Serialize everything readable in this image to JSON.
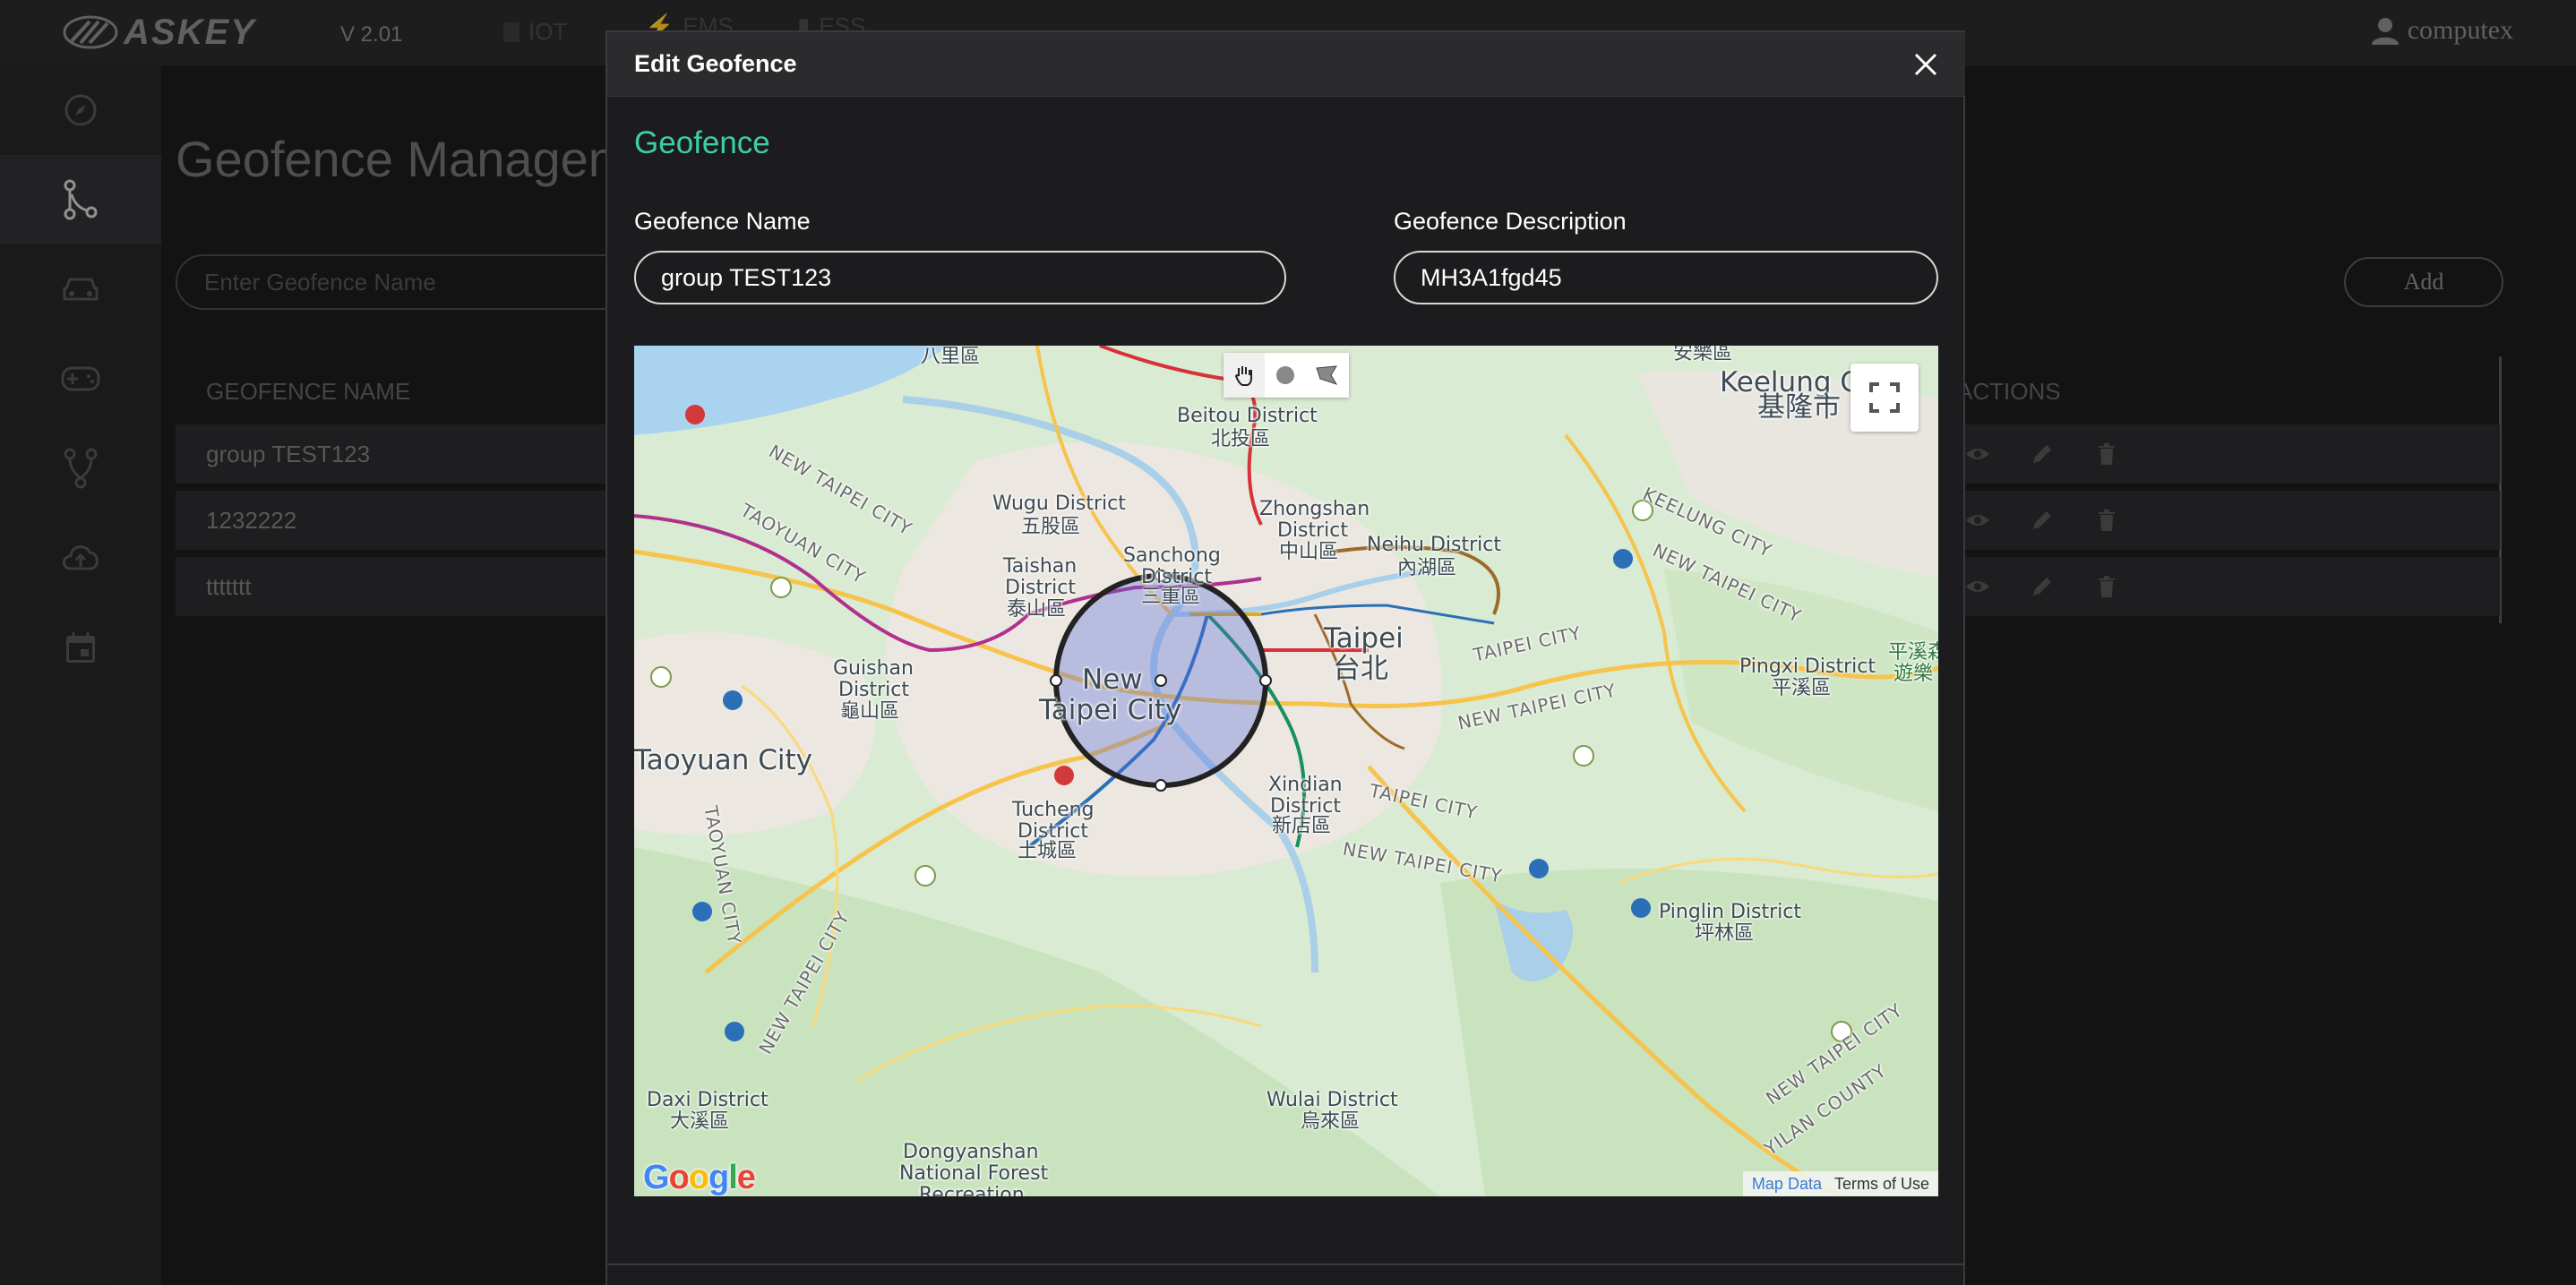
{
  "header": {
    "brand": "ASKEY",
    "version": "V 2.01",
    "nav_tabs": [
      "IOT",
      "EMS",
      "ESS"
    ],
    "user": "computex"
  },
  "sidebar": {
    "items": [
      {
        "name": "compass-icon"
      },
      {
        "name": "geofence-icon",
        "active": true
      },
      {
        "name": "car-icon"
      },
      {
        "name": "gamepad-icon"
      },
      {
        "name": "fork-icon"
      },
      {
        "name": "cloud-upload-icon"
      },
      {
        "name": "calendar-icon"
      }
    ]
  },
  "page": {
    "title": "Geofence Management",
    "search_placeholder": "Enter Geofence Name",
    "add_label": "Add",
    "columns": {
      "name": "GEOFENCE NAME",
      "actions": "ACTIONS"
    },
    "rows": [
      {
        "name": "group TEST123"
      },
      {
        "name": "1232222"
      },
      {
        "name": "ttttttt"
      }
    ]
  },
  "modal": {
    "title": "Edit Geofence",
    "section": "Geofence",
    "name_label": "Geofence Name",
    "name_value": "group TEST123",
    "desc_label": "Geofence Description",
    "desc_value": "MH3A1fgd45"
  },
  "map": {
    "labels": {
      "bali": "八里區",
      "beitou": "Beitou District",
      "beitou_zh": "北投區",
      "keelung": "Keelung City",
      "keelung_zh": "基隆市",
      "anle": "安樂區",
      "wugu": "Wugu District",
      "wugu_zh": "五股區",
      "zhongshan": "Zhongshan",
      "zhongshan2": "District",
      "zhongshan_zh": "中山區",
      "neihu": "Neihu District",
      "neihu_zh": "內湖區",
      "sanchong": "Sanchong",
      "sanchong2": "District",
      "sanchong_zh": "三重區",
      "taishan": "Taishan",
      "taishan2": "District",
      "taishan_zh": "泰山區",
      "taipei": "Taipei",
      "taipei_zh": "台北",
      "newtaipei1": "New",
      "newtaipei2": "Taipei City",
      "guishan": "Guishan",
      "guishan2": "District",
      "guishan_zh": "龜山區",
      "taoyuan": "Taoyuan City",
      "pingxi": "Pingxi District",
      "pingxi_zh": "平溪區",
      "pingxi_green": "平溪森",
      "pingxi_green2": "遊樂",
      "xindian": "Xindian",
      "xindian2": "District",
      "xindian_zh": "新店區",
      "tucheng": "Tucheng",
      "tucheng2": "District",
      "tucheng_zh": "土城區",
      "pinglin": "Pinglin District",
      "pinglin_zh": "坪林區",
      "daxi": "Daxi District",
      "daxi_zh": "大溪區",
      "wulai": "Wulai District",
      "wulai_zh": "烏來區",
      "dongyanshan": "Dongyanshan",
      "dongyanshan2": "National Forest",
      "dongyanshan3": "Recreation",
      "road_ntc": "NEW TAIPEI CITY",
      "road_taoyuan": "TAOYUAN CITY",
      "road_keelung": "KEELUNG CITY",
      "road_taipei": "TAIPEI CITY",
      "road_yilan": "YILAN COUNTY"
    },
    "google": "Google",
    "map_data": "Map Data",
    "terms": "Terms of Use"
  }
}
